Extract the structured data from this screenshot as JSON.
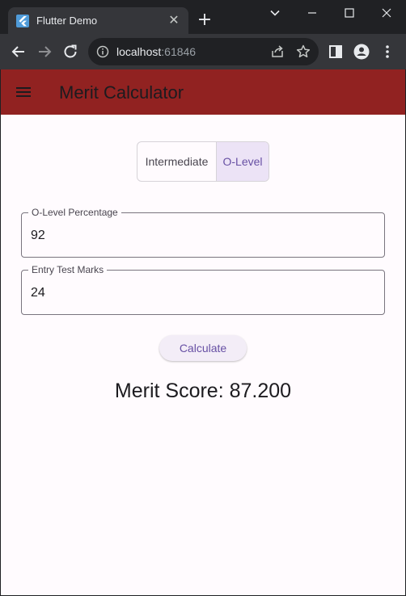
{
  "browser": {
    "tab_title": "Flutter Demo",
    "url_host": "localhost",
    "url_port": ":61846"
  },
  "app": {
    "title": "Merit Calculator",
    "segments": [
      "Intermediate",
      "O-Level"
    ],
    "selected_segment": "O-Level",
    "fields": [
      {
        "label": "O-Level Percentage",
        "value": "92"
      },
      {
        "label": "Entry Test Marks",
        "value": "24"
      }
    ],
    "calculate_label": "Calculate",
    "result": "Merit Score: 87.200"
  },
  "colors": {
    "app_bar": "#912221",
    "accent": "#6750a4",
    "selected_segment_bg": "#ece3f6",
    "background": "#fffbfe"
  }
}
